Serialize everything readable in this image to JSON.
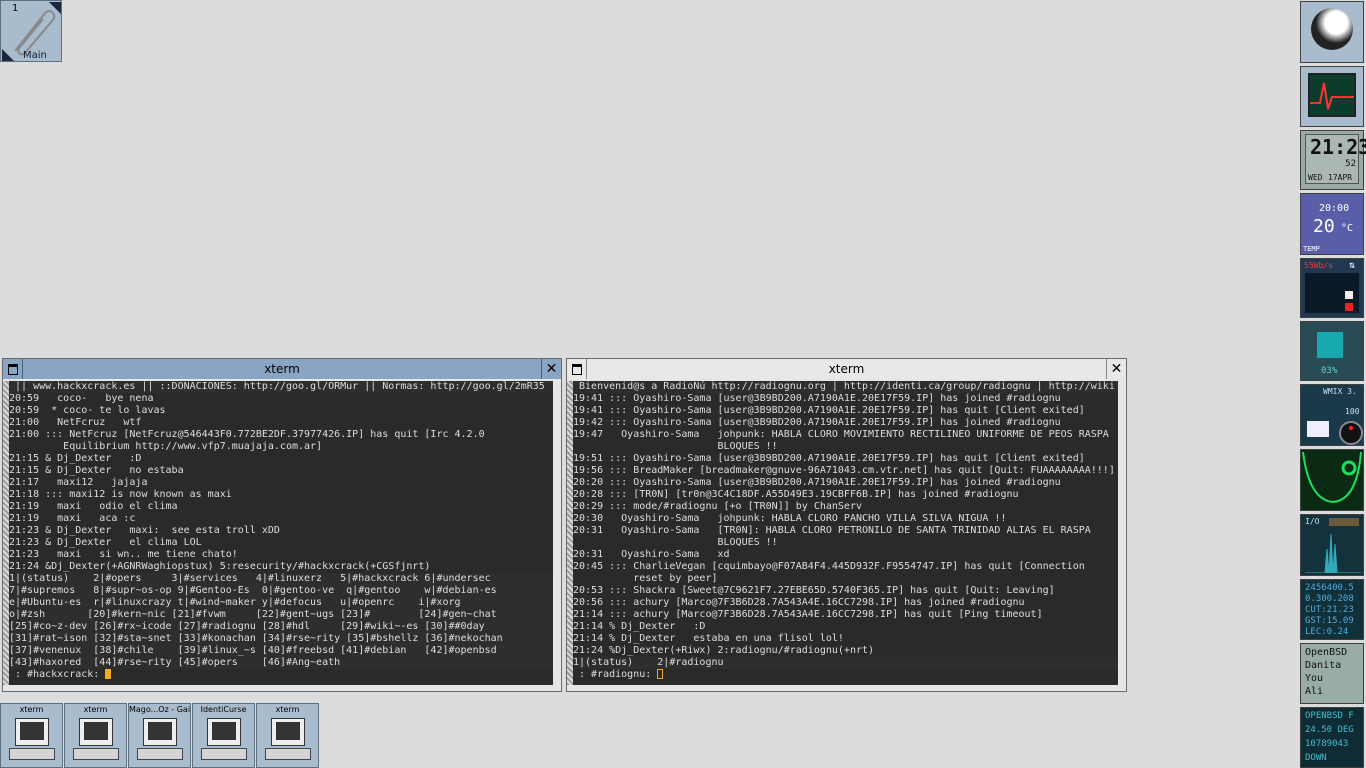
{
  "pager": {
    "desk_number": "1",
    "desk_label": "Main"
  },
  "xterm_left": {
    "title": "xterm",
    "lines": [
      " || www.hackxcrack.es || ::DONACIONES: http://goo.gl/ORMur || Normas: http://goo.gl/2mR35",
      "20:59   coco-   bye nena",
      "20:59  * coco- te lo lavas",
      "21:00   NetFcruz   wtf",
      "21:00 ::: NetFcruz [NetFcruz@546443F0.772BE2DF.37977426.IP] has quit [Irc 4.2.0",
      "         Equilibrium http://www.vfp7.muajaja.com.ar]",
      "21:15 & Dj_Dexter   :D",
      "21:15 & Dj_Dexter   no estaba",
      "21:17   maxi12   jajaja",
      "21:18 ::: maxi12 is now known as maxi",
      "21:19   maxi   odio el clima",
      "21:19   maxi   aca :c",
      "21:23 & Dj_Dexter   maxi:  see esta troll xDD",
      "21:23 & Dj_Dexter   el clima LOL",
      "21:23   maxi   si wn.. me tiene chato!",
      "21:24 &Dj_Dexter(+AGNRWaghiopstux) 5:resecurity/#hackxcrack(+CGSfjnrt)",
      "1|(status)    2|#opers     3|#services   4|#linuxerz   5|#hackxcrack 6|#undersec",
      "7|#supremos   8|#supr~os-op 9|#Gentoo-Es  0|#gentoo-ve  q|#gentoo    w|#debian-es",
      "e|#Ubuntu-es  r|#linuxcrazy t|#wind~maker y|#defocus   u|#openrc    i|#xorg",
      "o|#zsh       [20]#kern~nic [21]#fvwm     [22]#gent~ugs [23]#        [24]#gen~chat",
      "[25]#co~z-dev [26]#rx~icode [27]#radiognu [28]#hdl     [29]#wiki~-es [30]##0day",
      "[31]#rat~ison [32]#sta~snet [33]#konachan [34]#rse~rity [35]#bshellz [36]#nekochan",
      "[37]#venenux  [38]#chile    [39]#linux_~s [40]#freebsd [41]#debian   [42]#openbsd",
      "[43]#haxored  [44]#rse~rity [45]#opers    [46]#Ang~eath",
      " : #hackxcrack: "
    ]
  },
  "xterm_right": {
    "title": "xterm",
    "lines": [
      " Bienvenid@s a RadioÑú http://radiognu.org | http://identi.ca/group/radiognu | http://wiki",
      "19:41 ::: Oyashiro-Sama [user@3B9BD200.A7190A1E.20E17F59.IP] has joined #radiognu",
      "19:41 ::: Oyashiro-Sama [user@3B9BD200.A7190A1E.20E17F59.IP] has quit [Client exited]",
      "19:42 ::: Oyashiro-Sama [user@3B9BD200.A7190A1E.20E17F59.IP] has joined #radiognu",
      "19:47   Oyashiro-Sama   johpunk: HABLA CLORO MOVIMIENTO RECTILINEO UNIFORME DE PEOS RASPA",
      "                        BLOQUES !!",
      "19:51 ::: Oyashiro-Sama [user@3B9BD200.A7190A1E.20E17F59.IP] has quit [Client exited]",
      "19:56 ::: BreadMaker [breadmaker@gnuve-96A71043.cm.vtr.net] has quit [Quit: FUAAAAAAAA!!!]",
      "20:20 ::: Oyashiro-Sama [user@3B9BD200.A7190A1E.20E17F59.IP] has joined #radiognu",
      "20:28 ::: [TR0N] [tr0n@3C4C18DF.A55D49E3.19CBFF6B.IP] has joined #radiognu",
      "20:29 ::: mode/#radiognu [+o [TR0N]] by ChanServ",
      "20:30   Oyashiro-Sama   johpunk: HABLA CLORO PANCHO VILLA SILVA NIGUA !!",
      "20:31   Oyashiro-Sama   [TR0N]: HABLA CLORO PETRONILO DE SANTA TRINIDAD ALIAS EL RASPA",
      "                        BLOQUES !!",
      "20:31   Oyashiro-Sama   xd",
      "20:45 ::: CharlieVegan [cquimbayo@F07AB4F4.445D932F.F9554747.IP] has quit [Connection",
      "          reset by peer]",
      "20:53 ::: Shackra [Sweet@7C9621F7.27EBE65D.5740F365.IP] has quit [Quit: Leaving]",
      "20:56 ::: achury [Marco@7F3B6D28.7A543A4E.16CC7298.IP] has joined #radiognu",
      "21:14 ::: achury [Marco@7F3B6D28.7A543A4E.16CC7298.IP] has quit [Ping timeout]",
      "21:14 % Dj_Dexter   :D",
      "21:14 % Dj_Dexter   estaba en una flisol lol!",
      "21:24 %Dj_Dexter(+Riwx) 2:radiognu/#radiognu(+nrt)",
      "1|(status)    2|#radiognu",
      " : #radiognu: "
    ]
  },
  "taskbar": [
    {
      "label": "xterm"
    },
    {
      "label": "xterm"
    },
    {
      "label": "Mago...Oz - Gaia"
    },
    {
      "label": "IdentiCurse"
    },
    {
      "label": "xterm"
    }
  ],
  "dock": {
    "clock_time": "21:23",
    "clock_seconds": "52",
    "clock_day": "WED",
    "clock_date": "17APR",
    "weather_time": "20:00",
    "weather_temp": "20",
    "weather_unit": "°C",
    "weather_label": "TEMP",
    "net_rate": "55Wb/s",
    "cpu_label": "03%",
    "mixer_label": "WMIX 3.",
    "mixer_value": "100",
    "io_label": "I/O",
    "astro_lines": [
      "2456400.5",
      "0.300.208",
      "CUT:21.23",
      "GST:15.09",
      "LEC:0.24"
    ],
    "users_lines": [
      "OpenBSD",
      "Danita",
      "You",
      "Ali"
    ],
    "sys_lines": [
      "OPENBSD F",
      "24.50 DEG",
      "10789043",
      "DOWN"
    ]
  }
}
